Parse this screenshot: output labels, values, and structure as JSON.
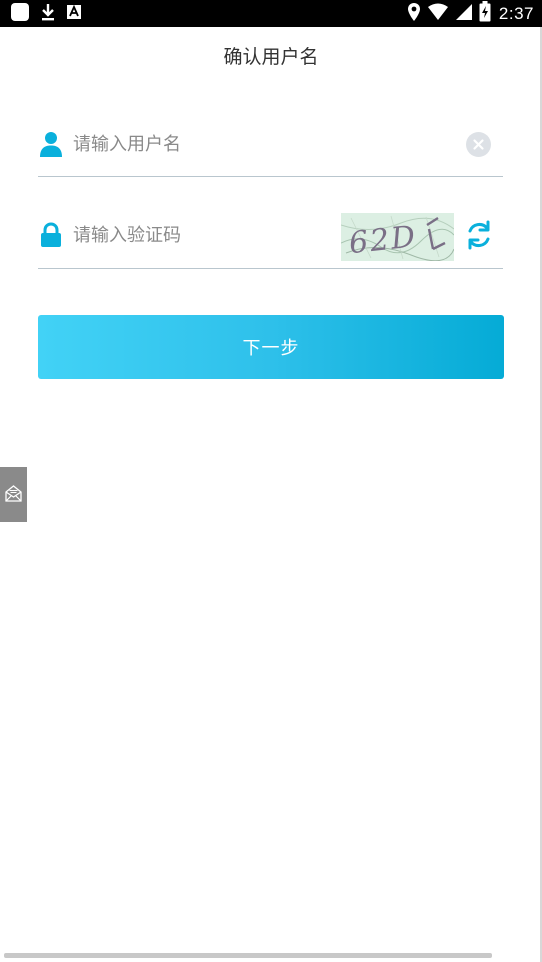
{
  "status_bar": {
    "time": "2:37",
    "icons": [
      "app-square-icon",
      "download-icon",
      "font-a-icon",
      "location-icon",
      "wifi-icon",
      "signal-icon",
      "battery-charging-icon"
    ]
  },
  "header": {
    "title": "确认用户名"
  },
  "form": {
    "username": {
      "placeholder": "请输入用户名",
      "value": "",
      "icon": "user-icon"
    },
    "captcha": {
      "placeholder": "请输入验证码",
      "value": "",
      "icon": "lock-icon",
      "image_text": "62D",
      "refresh_icon": "refresh-icon"
    },
    "next_label": "下一步"
  },
  "colors": {
    "accent": "#0ab0dc",
    "button_start": "#42d2f6",
    "button_end": "#05abd6",
    "divider": "#b9c6ce",
    "side_tab": "#8a8a8a"
  },
  "side_tab": {
    "icon": "mail-icon"
  }
}
